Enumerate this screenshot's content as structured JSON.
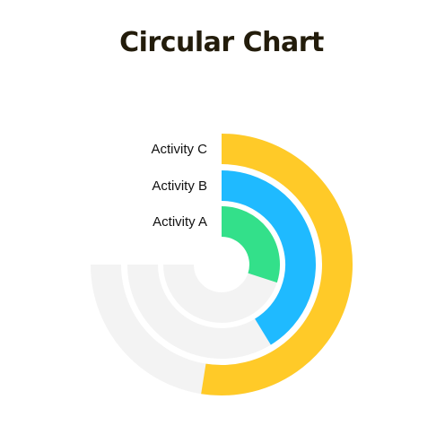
{
  "chart_data": {
    "type": "radial-bar",
    "title": "Circular Chart",
    "max": 100,
    "series": [
      {
        "name": "Activity A",
        "value": 40,
        "color": "#33e08a"
      },
      {
        "name": "Activity B",
        "value": 55,
        "color": "#1fbaff"
      },
      {
        "name": "Activity C",
        "value": 70,
        "color": "#ffca28"
      }
    ],
    "track_color": "#f3f3f3"
  }
}
